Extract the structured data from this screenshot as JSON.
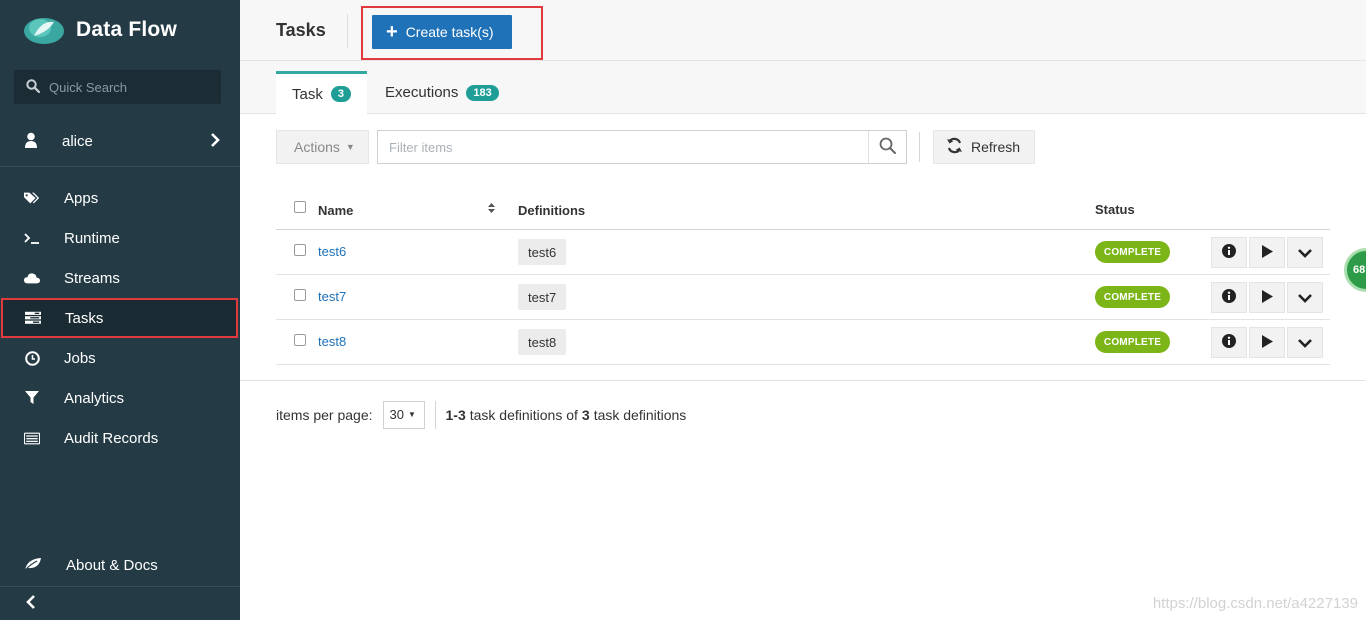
{
  "app": {
    "brand": "Data Flow"
  },
  "sidebar": {
    "search_label": "Quick Search",
    "user": "alice",
    "items": [
      {
        "label": "Apps",
        "icon": "tags-icon"
      },
      {
        "label": "Runtime",
        "icon": "terminal-icon"
      },
      {
        "label": "Streams",
        "icon": "cloud-icon"
      },
      {
        "label": "Tasks",
        "icon": "tasks-icon",
        "active": true
      },
      {
        "label": "Jobs",
        "icon": "clock-icon"
      },
      {
        "label": "Analytics",
        "icon": "filter-icon"
      },
      {
        "label": "Audit Records",
        "icon": "list-icon"
      }
    ],
    "about": "About & Docs"
  },
  "header": {
    "title": "Tasks",
    "create_label": "Create task(s)"
  },
  "tabs": [
    {
      "label": "Task",
      "count": "3",
      "active": true
    },
    {
      "label": "Executions",
      "count": "183",
      "active": false
    }
  ],
  "toolbar": {
    "actions_label": "Actions",
    "filter_placeholder": "Filter items",
    "refresh_label": "Refresh"
  },
  "table": {
    "columns": [
      "Name",
      "Definitions",
      "Status"
    ],
    "rows": [
      {
        "name": "test6",
        "definition": "test6",
        "status": "COMPLETE"
      },
      {
        "name": "test7",
        "definition": "test7",
        "status": "COMPLETE"
      },
      {
        "name": "test8",
        "definition": "test8",
        "status": "COMPLETE"
      }
    ]
  },
  "pagination": {
    "items_per_page_label": "items per page:",
    "per_page": "30",
    "range": "1-3",
    "text_mid": "task definitions of",
    "total": "3",
    "text_end": "task definitions"
  },
  "colors": {
    "sidebar_bg": "#243b46",
    "primary": "#1f72b8",
    "teal": "#1f9e98",
    "complete": "#7cb518",
    "highlight": "#e0393e"
  },
  "watermark": "https://blog.csdn.net/a4227139",
  "floating_badge": "68"
}
